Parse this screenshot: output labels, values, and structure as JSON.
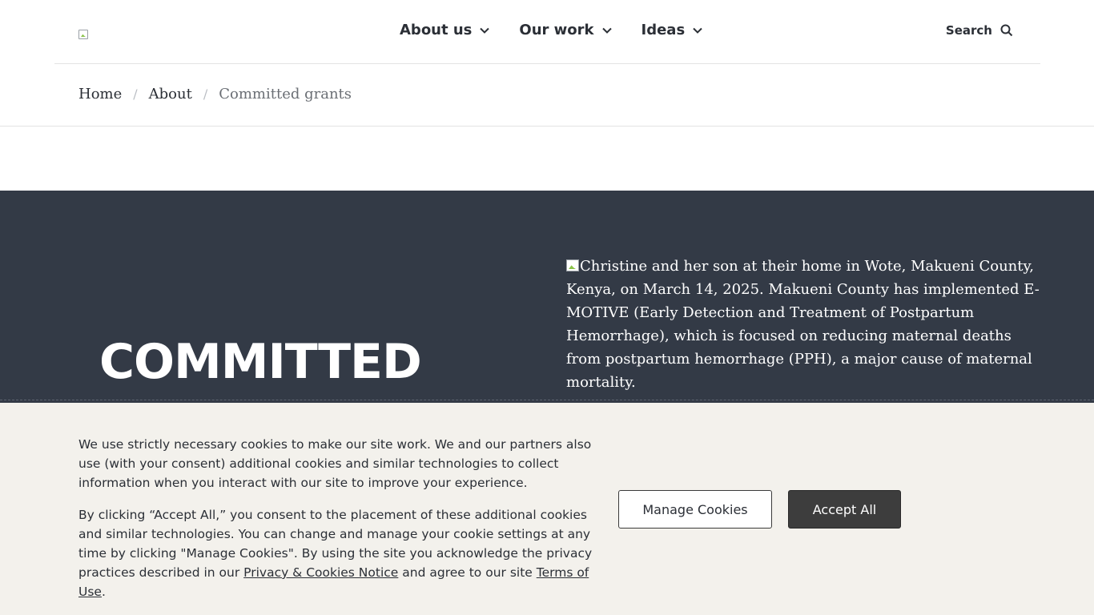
{
  "header": {
    "logo_alt": "",
    "nav": [
      {
        "label": "About us"
      },
      {
        "label": "Our work"
      },
      {
        "label": "Ideas"
      }
    ],
    "search_label": "Search"
  },
  "breadcrumb": {
    "home": "Home",
    "about": "About",
    "current": "Committed grants",
    "separator": "/"
  },
  "hero": {
    "title": "COMMITTED",
    "image_alt": "Christine and her son at their home in Wote, Makueni County, Kenya, on March 14, 2025. Makueni County has implemented E-MOTIVE (Early Detection and Treatment of Postpartum Hemorrhage), which is focused on reducing maternal deaths from postpartum hemorrhage (PPH), a major cause of maternal mortality."
  },
  "cookie_banner": {
    "paragraph1": "We use strictly necessary cookies to make our site work. We and our partners also use (with your consent) additional cookies and similar technologies to collect information when you interact with our site to improve your experience.",
    "paragraph2_start": "By clicking “Accept All,” you consent to the placement of these additional cookies and similar technologies. You can change and manage your cookie settings at any time by clicking \"Manage Cookies\". By using the site you acknowledge the privacy practices described in our ",
    "privacy_link": "Privacy & Cookies Notice",
    "paragraph2_mid": " and agree to our site ",
    "terms_link": "Terms of Use",
    "paragraph2_end": ".",
    "manage_button": "Manage Cookies",
    "accept_button": "Accept All"
  },
  "colors": {
    "hero_bg": "#333a46",
    "banner_bg": "#f3f1ec",
    "accept_bg": "#3d3d3d"
  }
}
